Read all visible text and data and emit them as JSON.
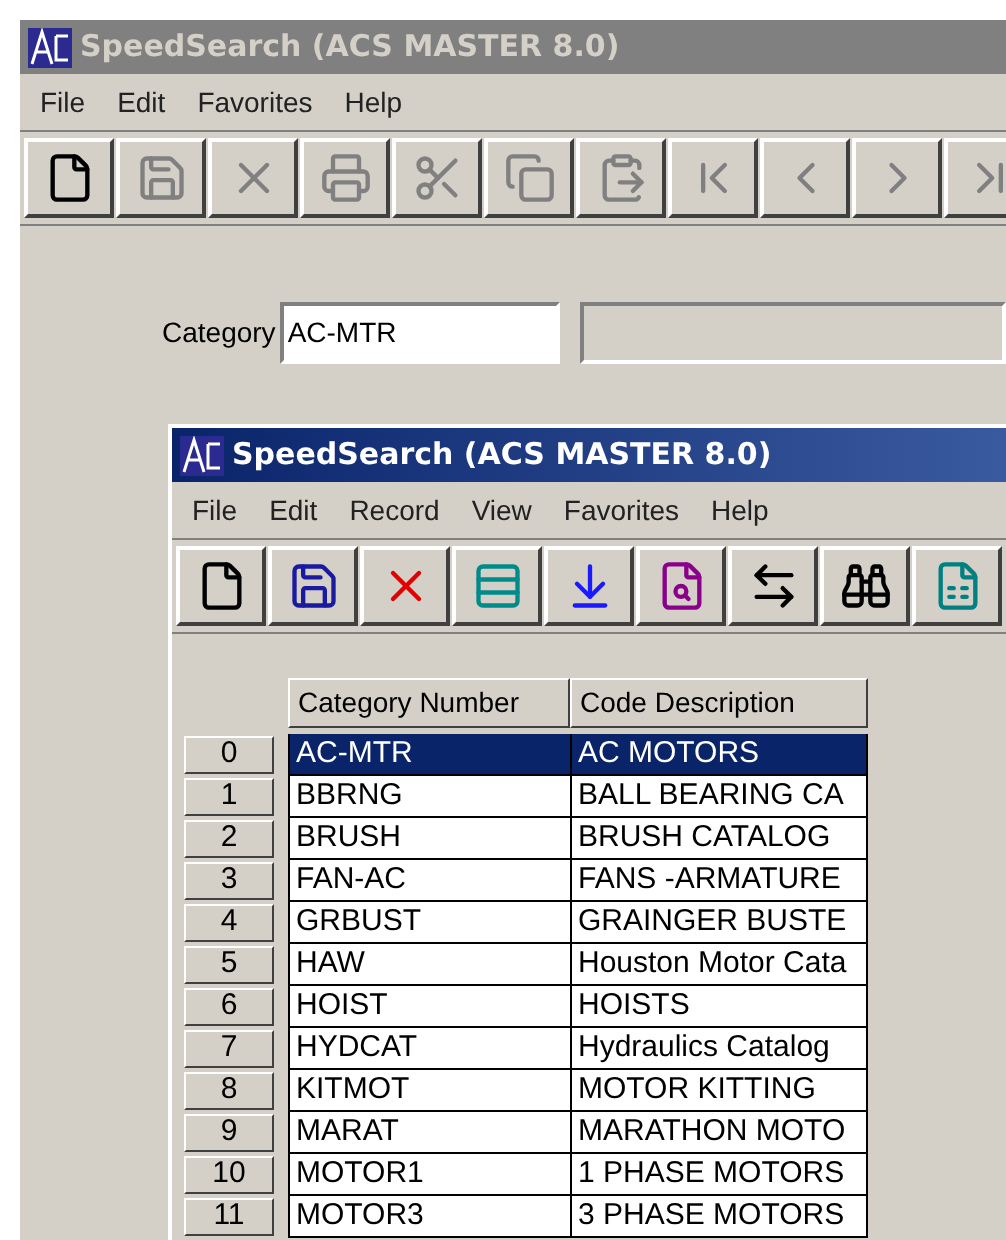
{
  "outer_window": {
    "title": "SpeedSearch (ACS MASTER 8.0)",
    "active": false,
    "menu": [
      "File",
      "Edit",
      "Favorites",
      "Help"
    ],
    "toolbar": [
      {
        "kind": "new",
        "disabled": false
      },
      {
        "kind": "save",
        "disabled": true
      },
      {
        "kind": "delete",
        "disabled": true
      },
      {
        "kind": "print",
        "disabled": true
      },
      {
        "kind": "cut",
        "disabled": true
      },
      {
        "kind": "copy",
        "disabled": true
      },
      {
        "kind": "paste",
        "disabled": true
      },
      {
        "kind": "first",
        "disabled": true
      },
      {
        "kind": "prev",
        "disabled": true
      },
      {
        "kind": "next",
        "disabled": true
      },
      {
        "kind": "last",
        "disabled": true
      }
    ],
    "category": {
      "label": "Category",
      "value": "AC-MTR"
    }
  },
  "inner_window": {
    "title": "SpeedSearch (ACS MASTER 8.0)",
    "active": true,
    "menu": [
      "File",
      "Edit",
      "Record",
      "View",
      "Favorites",
      "Help"
    ],
    "toolbar": [
      {
        "kind": "new",
        "disabled": false
      },
      {
        "kind": "save",
        "disabled": false
      },
      {
        "kind": "delete",
        "disabled": false
      },
      {
        "kind": "insert-row",
        "disabled": false
      },
      {
        "kind": "merge",
        "disabled": false
      },
      {
        "kind": "find-doc",
        "disabled": false
      },
      {
        "kind": "tab",
        "disabled": false
      },
      {
        "kind": "binoculars",
        "disabled": false
      },
      {
        "kind": "excel",
        "disabled": false
      }
    ],
    "table": {
      "columns": [
        "Category Number",
        "Code Description"
      ],
      "rows": [
        {
          "index": "0",
          "cells": [
            "AC-MTR",
            "AC MOTORS"
          ],
          "selected": true
        },
        {
          "index": "1",
          "cells": [
            "BBRNG",
            "BALL BEARING CA"
          ],
          "selected": false
        },
        {
          "index": "2",
          "cells": [
            "BRUSH",
            "BRUSH CATALOG"
          ],
          "selected": false
        },
        {
          "index": "3",
          "cells": [
            "FAN-AC",
            "FANS -ARMATURE"
          ],
          "selected": false
        },
        {
          "index": "4",
          "cells": [
            "GRBUST",
            "GRAINGER BUSTE"
          ],
          "selected": false
        },
        {
          "index": "5",
          "cells": [
            "HAW",
            "Houston Motor Cata"
          ],
          "selected": false
        },
        {
          "index": "6",
          "cells": [
            "HOIST",
            "HOISTS"
          ],
          "selected": false
        },
        {
          "index": "7",
          "cells": [
            "HYDCAT",
            "Hydraulics Catalog"
          ],
          "selected": false
        },
        {
          "index": "8",
          "cells": [
            "KITMOT",
            "MOTOR KITTING"
          ],
          "selected": false
        },
        {
          "index": "9",
          "cells": [
            "MARAT",
            "MARATHON MOTO"
          ],
          "selected": false
        },
        {
          "index": "10",
          "cells": [
            "MOTOR1",
            "1 PHASE MOTORS"
          ],
          "selected": false
        },
        {
          "index": "11",
          "cells": [
            "MOTOR3",
            "3 PHASE MOTORS"
          ],
          "selected": false
        }
      ]
    }
  }
}
